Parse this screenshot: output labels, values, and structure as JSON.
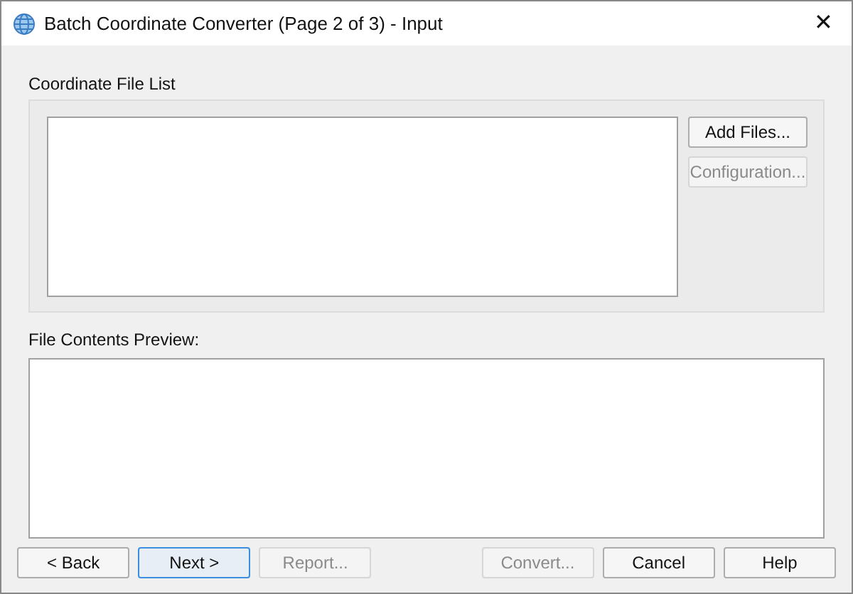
{
  "window": {
    "title": "Batch Coordinate Converter (Page 2 of 3) - Input",
    "close": "✕"
  },
  "file_list_group": {
    "label": "Coordinate File List",
    "buttons": [
      {
        "label": "Add Files...",
        "disabled": false
      },
      {
        "label": "Configuration...",
        "disabled": true
      }
    ]
  },
  "preview": {
    "label": "File Contents Preview:"
  },
  "buttons": [
    {
      "label": "< Back",
      "disabled": false,
      "default": false
    },
    {
      "label": "Next >",
      "disabled": false,
      "default": true
    },
    {
      "label": "Report...",
      "disabled": true
    },
    {
      "label": "Convert...",
      "disabled": true
    },
    {
      "label": "Cancel",
      "disabled": false,
      "default": false
    },
    {
      "label": "Help",
      "disabled": false,
      "default": false
    }
  ]
}
